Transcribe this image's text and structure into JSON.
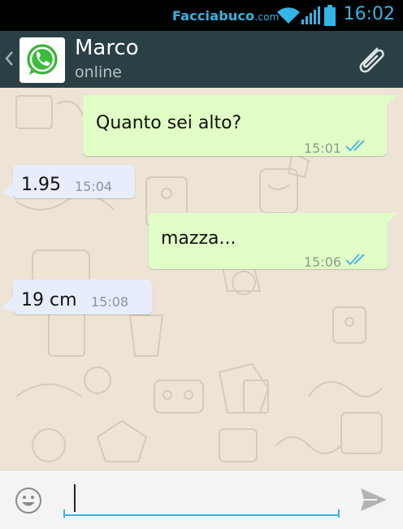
{
  "status_bar": {
    "watermark_main": "Facciabuco",
    "watermark_suffix": ".com",
    "time": "16:02",
    "icons": [
      "wifi-icon",
      "signal-icon",
      "battery-icon"
    ]
  },
  "header": {
    "contact_name": "Marco",
    "contact_status": "online",
    "icons": [
      "back-chevron-icon",
      "whatsapp-avatar-icon",
      "paperclip-icon"
    ]
  },
  "messages": [
    {
      "direction": "out",
      "text": "Quanto sei alto?",
      "time": "15:01",
      "read": true
    },
    {
      "direction": "in",
      "text": "1.95",
      "time": "15:04"
    },
    {
      "direction": "out",
      "text": "mazza...",
      "time": "15:06",
      "read": true
    },
    {
      "direction": "in",
      "text": "19 cm",
      "time": "15:08"
    }
  ],
  "input_bar": {
    "placeholder": "",
    "value": "",
    "icons": [
      "emoji-icon",
      "send-icon"
    ]
  },
  "colors": {
    "status_accent": "#33b5e5",
    "header_bg": "#2b4045",
    "outgoing_bubble": "#e1fec6",
    "incoming_bubble": "#e7edfb",
    "read_ticks": "#4fb8e8",
    "chat_bg": "#ede4d6"
  }
}
